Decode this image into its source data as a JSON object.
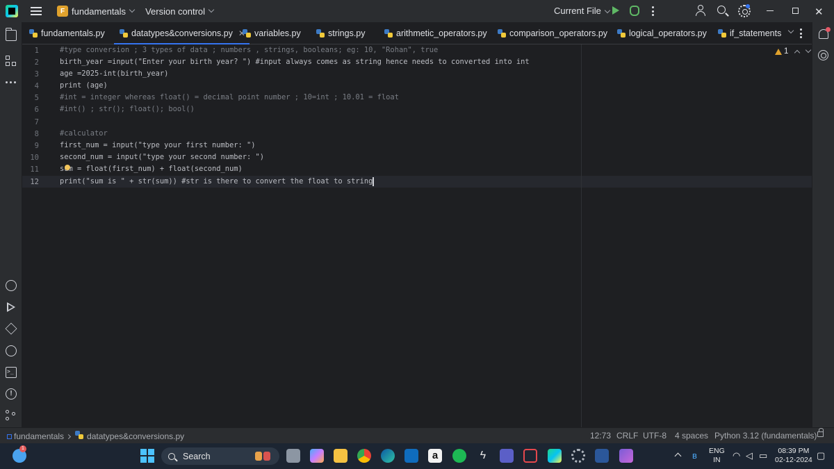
{
  "titlebar": {
    "project_badge": "F",
    "project_name": "fundamentals",
    "vcs_label": "Version control",
    "run_config": "Current File"
  },
  "tabs": [
    {
      "label": "fundamentals.py",
      "active": false
    },
    {
      "label": "datatypes&conversions.py",
      "active": true
    },
    {
      "label": "variables.py",
      "active": false
    },
    {
      "label": "strings.py",
      "active": false
    },
    {
      "label": "arithmetic_operators.py",
      "active": false
    },
    {
      "label": "comparison_operators.py",
      "active": false
    },
    {
      "label": "logical_operators.py",
      "active": false
    },
    {
      "label": "if_statements",
      "active": false
    }
  ],
  "editor": {
    "line_numbers": [
      "1",
      "2",
      "3",
      "4",
      "5",
      "6",
      "7",
      "8",
      "9",
      "10",
      "11",
      "12"
    ],
    "current_line": "12",
    "code": [
      "#type conversion ; 3 types of data ; numbers , strings, booleans; eg: 10, \"Rohan\", true",
      "birth_year =input(\"Enter your birth year? \") #input always comes as string hence needs to converted into int",
      "age =2025-int(birth_year)",
      "print (age)",
      "#int = integer whereas float() = decimal point number ; 10=int ; 10.01 = float",
      "#int() ; str(); float(); bool()",
      "",
      "#calculator",
      "first_num = input(\"type your first number: \")",
      "second_num = input(\"type your second number: \")",
      "sum = float(first_num) + float(second_num)",
      "print(\"sum is \" + str(sum)) #str is there to convert the float to string"
    ],
    "warning_count": "1"
  },
  "statusbar": {
    "breadcrumb_project": "fundamentals",
    "breadcrumb_file": "datatypes&conversions.py",
    "caret_position": "12:73",
    "line_separator": "CRLF",
    "encoding": "UTF-8",
    "indent": "4 spaces",
    "interpreter": "Python 3.12 (fundamentals)"
  },
  "taskbar": {
    "weather_badge": "1",
    "search_label": "Search",
    "language_line1": "ENG",
    "language_line2": "IN",
    "time": "08:39 PM",
    "date": "02-12-2024"
  },
  "colors": {
    "accent": "#3574f0",
    "editor_bg": "#1e1f22",
    "panel_bg": "#2b2d30",
    "run_green": "#5fb865",
    "warning": "#e0a22d",
    "string": "#6aab73",
    "comment": "#7a7e85",
    "number": "#2aacb8",
    "function": "#56a8f5"
  }
}
